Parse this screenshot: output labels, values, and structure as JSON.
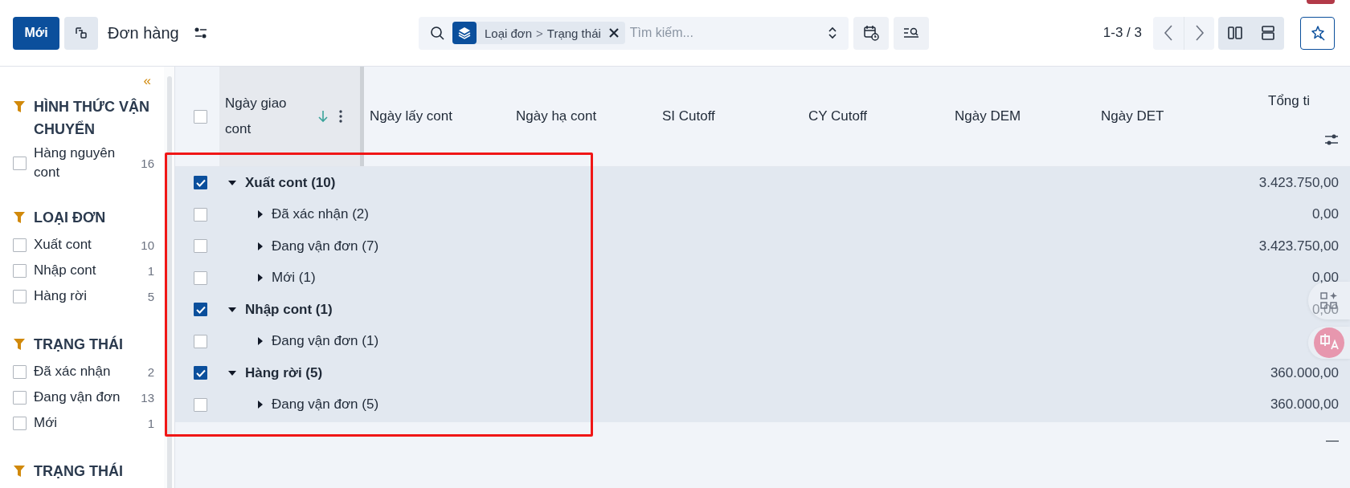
{
  "control_panel": {
    "new_button": "Mới",
    "title": "Đơn hàng"
  },
  "search": {
    "facet_fields": [
      "Loại đơn",
      "Trạng thái"
    ],
    "facet_separator": ">",
    "placeholder": "Tìm kiếm..."
  },
  "pager": {
    "value": "1-3 / 3"
  },
  "sidebar": {
    "collapse": "«",
    "sections": [
      {
        "title": "HÌNH THỨC VẬN CHUYỂN",
        "items": [
          {
            "label": "Hàng nguyên cont",
            "count": "16",
            "checked": false
          }
        ]
      },
      {
        "title": "LOẠI ĐƠN",
        "items": [
          {
            "label": "Xuất cont",
            "count": "10",
            "checked": false
          },
          {
            "label": "Nhập cont",
            "count": "1",
            "checked": false
          },
          {
            "label": "Hàng rời",
            "count": "5",
            "checked": false
          }
        ]
      },
      {
        "title": "TRẠNG THÁI",
        "items": [
          {
            "label": "Đã xác nhận",
            "count": "2",
            "checked": false
          },
          {
            "label": "Đang vận đơn",
            "count": "13",
            "checked": false
          },
          {
            "label": "Mới",
            "count": "1",
            "checked": false
          }
        ]
      },
      {
        "title": "TRẠNG THÁI"
      }
    ]
  },
  "table": {
    "select_all_checked": false,
    "columns": [
      {
        "label": "Ngày giao cont",
        "sorted": true
      },
      {
        "label": "Ngày lấy cont",
        "sorted": false
      },
      {
        "label": "Ngày hạ cont",
        "sorted": false
      },
      {
        "label": "SI Cutoff",
        "sorted": false
      },
      {
        "label": "CY Cutoff",
        "sorted": false
      },
      {
        "label": "Ngày DEM",
        "sorted": false
      },
      {
        "label": "Ngày DET",
        "sorted": false
      },
      {
        "label": "Tổng ti",
        "sorted": false
      }
    ],
    "groups": [
      {
        "label": "Xuất cont (10)",
        "checked": true,
        "expanded": true,
        "total": "3.423.750,00",
        "children": [
          {
            "label": "Đã xác nhận (2)",
            "checked": false,
            "expanded": false,
            "total": "0,00"
          },
          {
            "label": "Đang vận đơn (7)",
            "checked": false,
            "expanded": false,
            "total": "3.423.750,00"
          },
          {
            "label": "Mới (1)",
            "checked": false,
            "expanded": false,
            "total": "0,00"
          }
        ]
      },
      {
        "label": "Nhập cont (1)",
        "checked": true,
        "expanded": true,
        "total": "0,00",
        "children": [
          {
            "label": "Đang vận đơn (1)",
            "checked": false,
            "expanded": false
          }
        ]
      },
      {
        "label": "Hàng rời (5)",
        "checked": true,
        "expanded": true,
        "total": "360.000,00",
        "children": [
          {
            "label": "Đang vận đơn (5)",
            "checked": false,
            "expanded": false,
            "total": "360.000,00"
          }
        ]
      }
    ],
    "footer_total": "—"
  }
}
